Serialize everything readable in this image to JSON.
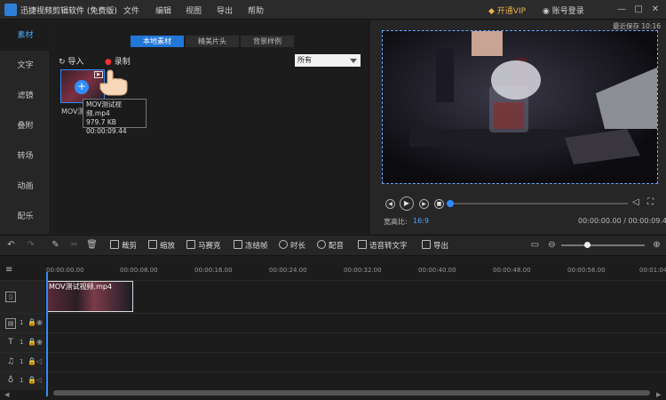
{
  "app": {
    "title": "迅捷视频剪辑软件 (免费版)",
    "menu": [
      "文件",
      "编辑",
      "视图",
      "导出",
      "帮助"
    ],
    "vip_label": "开通VIP",
    "login_label": "账号登录"
  },
  "window_controls": {
    "minimize": "—",
    "maximize": "□",
    "close": "✕"
  },
  "left_nav": [
    "素材",
    "文字",
    "滤镜",
    "叠附",
    "转场",
    "动画",
    "配乐"
  ],
  "media_panel": {
    "tabs": [
      "本地素材",
      "精美片头",
      "背景样例"
    ],
    "import_label": "导入",
    "record_label": "录制",
    "filter_value": "所有",
    "file": {
      "name": "MOV测试视频.mp4",
      "thumb_name": "MOV测",
      "size": "979.7 KB",
      "duration": "00:00:09.44"
    }
  },
  "preview": {
    "autosave": "最近保存 10:16",
    "aspect_label": "宽高比:",
    "aspect_value": "16:9",
    "timecode": "00:00:00.00 / 00:00:09.44"
  },
  "toolbar": {
    "crop": "裁剪",
    "zoom": "缩放",
    "mosaic": "马赛克",
    "freeze": "冻结帧",
    "duration": "时长",
    "dub": "配音",
    "speech_to_text": "语音转文字",
    "export": "导出"
  },
  "timeline": {
    "ticks": [
      "00:00:00.00",
      "00:00:08.00",
      "00:00:16.00",
      "00:00:24.00",
      "00:00:32.00",
      "00:00:40.00",
      "00:00:48.00",
      "00:00:56.00",
      "00:01:04"
    ],
    "clip_label": "MOV测试视频.mp4",
    "track_numbers": [
      "1",
      "1",
      "1",
      "1"
    ]
  },
  "colors": {
    "accent": "#2f8cff",
    "vip": "#e8b24a",
    "background": "#1c1c1c"
  }
}
